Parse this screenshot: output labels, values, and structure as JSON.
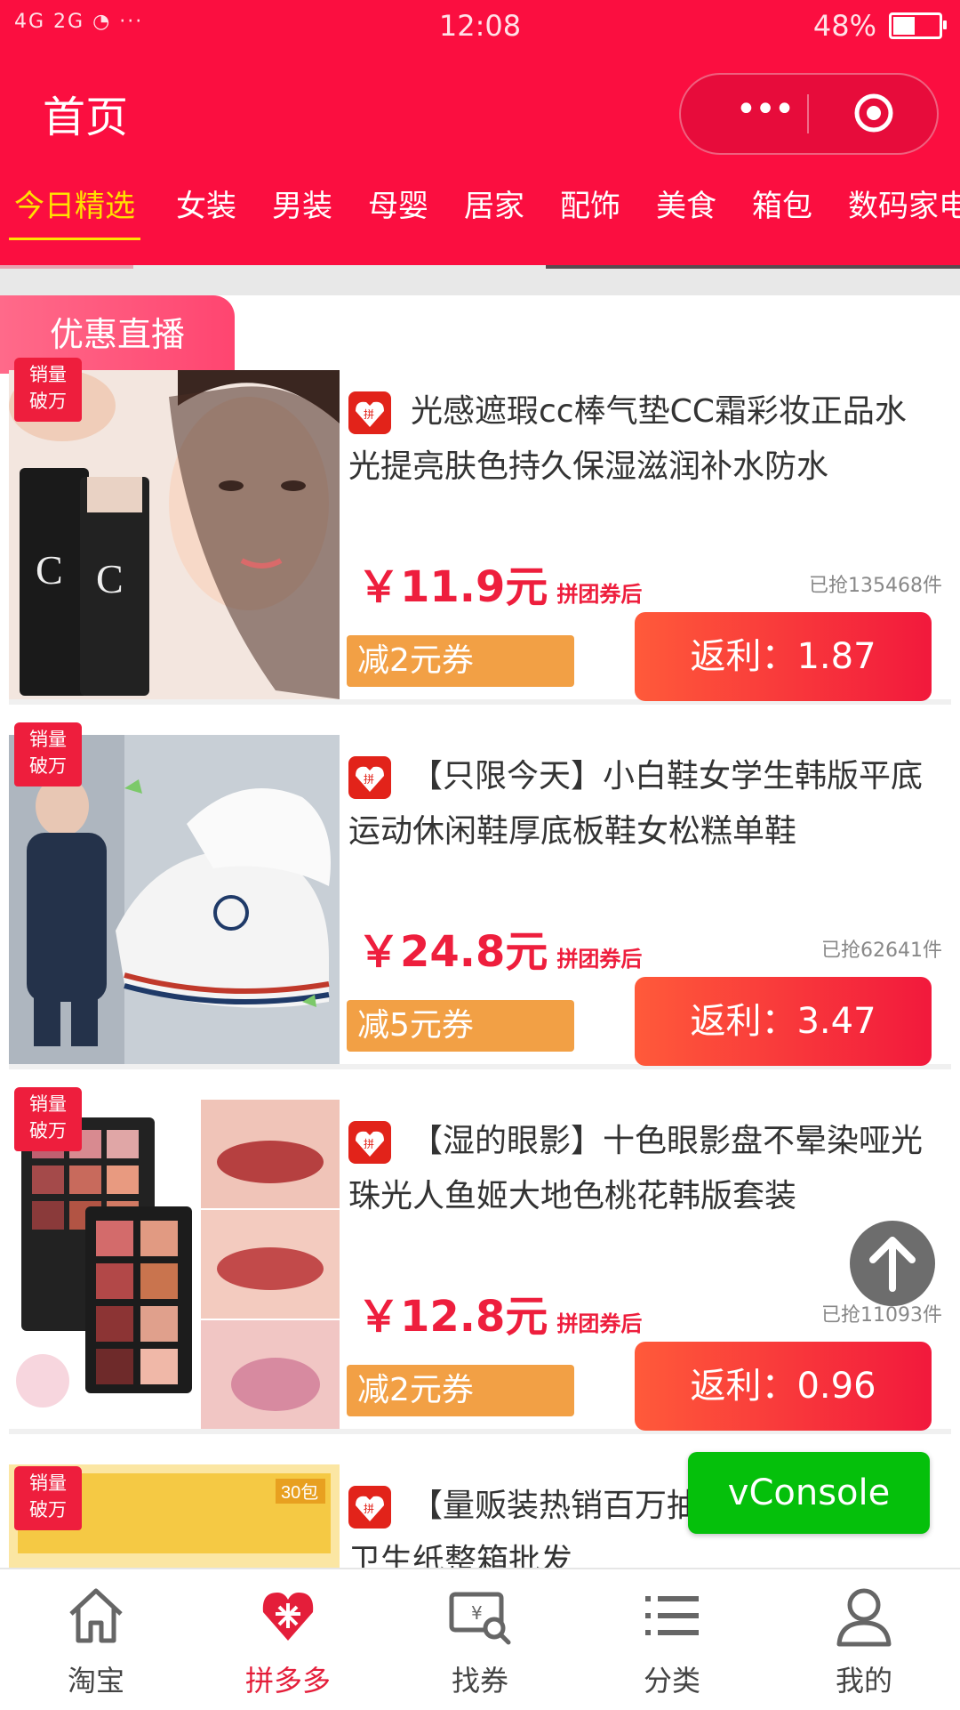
{
  "status_bar": {
    "signal": "4G 2G",
    "time": "12:08",
    "battery": "48%"
  },
  "header": {
    "title": "首页"
  },
  "tabs": [
    "今日精选",
    "女装",
    "男装",
    "母婴",
    "居家",
    "配饰",
    "美食",
    "箱包",
    "数码家电"
  ],
  "section": {
    "title": "优惠直播"
  },
  "items": [
    {
      "badge": "销量\n破万",
      "title": "光感遮瑕cc棒气垫CC霜彩妆正品水光提亮肤色持久保湿滋润补水防水",
      "price": "￥11.9元",
      "price_note": "拼团券后",
      "sold": "已抢135468件",
      "coupon": "减2元券",
      "rebate": "返利：1.87"
    },
    {
      "badge": "销量\n破万",
      "title": "【只限今天】小白鞋女学生韩版平底运动休闲鞋厚底板鞋女松糕单鞋",
      "price": "￥24.8元",
      "price_note": "拼团券后",
      "sold": "已抢62641件",
      "coupon": "减5元券",
      "rebate": "返利：3.47"
    },
    {
      "badge": "销量\n破万",
      "title": "【湿的眼影】十色眼影盘不晕染哑光珠光人鱼姬大地色桃花韩版套装",
      "price": "￥12.8元",
      "price_note": "拼团券后",
      "sold": "已抢11093件",
      "coupon": "减2元券",
      "rebate": "返利：0.96"
    },
    {
      "badge": "销量\n破万",
      "title": "【量贩装热销百万抽纸巾餐巾纸婴儿卫生纸整箱批发",
      "price": "",
      "price_note": "",
      "sold": "",
      "coupon": "",
      "rebate": ""
    }
  ],
  "floating": {
    "vconsole": "vConsole"
  },
  "bottom_nav": [
    {
      "label": "淘宝",
      "icon": "home-icon"
    },
    {
      "label": "拼多多",
      "icon": "pinduoduo-icon"
    },
    {
      "label": "找券",
      "icon": "coupon-search-icon"
    },
    {
      "label": "分类",
      "icon": "list-icon"
    },
    {
      "label": "我的",
      "icon": "user-icon"
    }
  ],
  "colors": {
    "brand": "#fb0e40",
    "active_tab": "#ffe100",
    "price": "#ee1e3d",
    "coupon": "#f2a045",
    "vconsole": "#05c00b"
  }
}
